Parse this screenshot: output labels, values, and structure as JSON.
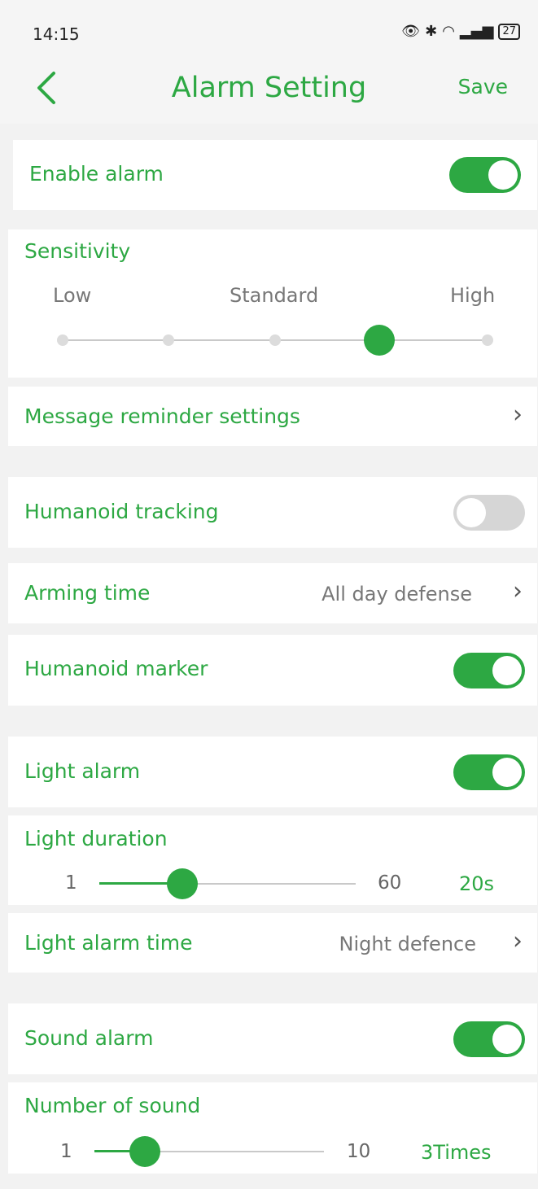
{
  "status": {
    "time": "14:15",
    "battery": "27"
  },
  "header": {
    "title": "Alarm Setting",
    "save_label": "Save"
  },
  "enable_alarm": {
    "label": "Enable alarm",
    "on": true
  },
  "sensitivity": {
    "label": "Sensitivity",
    "low": "Low",
    "standard": "Standard",
    "high": "High",
    "level_index": 3,
    "levels": 5
  },
  "message_reminder": {
    "label": "Message reminder settings"
  },
  "humanoid_tracking": {
    "label": "Humanoid tracking",
    "on": false
  },
  "arming_time": {
    "label": "Arming time",
    "value": "All day defense"
  },
  "humanoid_marker": {
    "label": "Humanoid marker",
    "on": true
  },
  "light_alarm": {
    "label": "Light alarm",
    "on": true
  },
  "light_duration": {
    "label": "Light duration",
    "min": "1",
    "max": "60",
    "value": "20s"
  },
  "light_alarm_time": {
    "label": "Light alarm time",
    "value": "Night defence"
  },
  "sound_alarm": {
    "label": "Sound alarm",
    "on": true
  },
  "number_of_sound": {
    "label": "Number of sound",
    "min": "1",
    "max": "10",
    "value": "3Times"
  },
  "colors": {
    "accent": "#2da843"
  }
}
